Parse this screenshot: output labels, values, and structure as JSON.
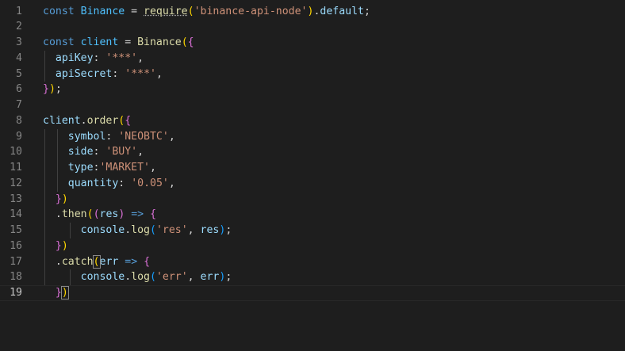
{
  "editor": {
    "active_line": 19,
    "lines": [
      {
        "n": "1",
        "tokens": [
          {
            "t": "const ",
            "c": "kw"
          },
          {
            "t": "Binance",
            "c": "var"
          },
          {
            "t": " = ",
            "c": "op"
          },
          {
            "t": "require",
            "c": "fn",
            "dotted": true
          },
          {
            "t": "(",
            "c": "p1"
          },
          {
            "t": "'binance-api-node'",
            "c": "str"
          },
          {
            "t": ")",
            "c": "p1"
          },
          {
            "t": ".",
            "c": "op"
          },
          {
            "t": "default",
            "c": "prop"
          },
          {
            "t": ";",
            "c": "op"
          }
        ]
      },
      {
        "n": "2",
        "tokens": []
      },
      {
        "n": "3",
        "tokens": [
          {
            "t": "const ",
            "c": "kw"
          },
          {
            "t": "client",
            "c": "var"
          },
          {
            "t": " = ",
            "c": "op"
          },
          {
            "t": "Binance",
            "c": "fn"
          },
          {
            "t": "(",
            "c": "p1"
          },
          {
            "t": "{",
            "c": "p2"
          }
        ]
      },
      {
        "n": "4",
        "tokens": [
          {
            "t": "  ",
            "c": "op"
          },
          {
            "t": "apiKey",
            "c": "prop"
          },
          {
            "t": ": ",
            "c": "op"
          },
          {
            "t": "'***'",
            "c": "str"
          },
          {
            "t": ",",
            "c": "op"
          }
        ]
      },
      {
        "n": "5",
        "tokens": [
          {
            "t": "  ",
            "c": "op"
          },
          {
            "t": "apiSecret",
            "c": "prop"
          },
          {
            "t": ": ",
            "c": "op"
          },
          {
            "t": "'***'",
            "c": "str"
          },
          {
            "t": ",",
            "c": "op"
          }
        ]
      },
      {
        "n": "6",
        "tokens": [
          {
            "t": "}",
            "c": "p2"
          },
          {
            "t": ")",
            "c": "p1"
          },
          {
            "t": ";",
            "c": "op"
          }
        ]
      },
      {
        "n": "7",
        "tokens": []
      },
      {
        "n": "8",
        "tokens": [
          {
            "t": "client",
            "c": "prop"
          },
          {
            "t": ".",
            "c": "op"
          },
          {
            "t": "order",
            "c": "fn"
          },
          {
            "t": "(",
            "c": "p1"
          },
          {
            "t": "{",
            "c": "p2"
          }
        ]
      },
      {
        "n": "9",
        "tokens": [
          {
            "t": "    ",
            "c": "op"
          },
          {
            "t": "symbol",
            "c": "prop"
          },
          {
            "t": ": ",
            "c": "op"
          },
          {
            "t": "'NEOBTC'",
            "c": "str"
          },
          {
            "t": ",",
            "c": "op"
          }
        ]
      },
      {
        "n": "10",
        "tokens": [
          {
            "t": "    ",
            "c": "op"
          },
          {
            "t": "side",
            "c": "prop"
          },
          {
            "t": ": ",
            "c": "op"
          },
          {
            "t": "'BUY'",
            "c": "str"
          },
          {
            "t": ",",
            "c": "op"
          }
        ]
      },
      {
        "n": "11",
        "tokens": [
          {
            "t": "    ",
            "c": "op"
          },
          {
            "t": "type",
            "c": "prop"
          },
          {
            "t": ":",
            "c": "op"
          },
          {
            "t": "'MARKET'",
            "c": "str"
          },
          {
            "t": ",",
            "c": "op"
          }
        ]
      },
      {
        "n": "12",
        "tokens": [
          {
            "t": "    ",
            "c": "op"
          },
          {
            "t": "quantity",
            "c": "prop"
          },
          {
            "t": ": ",
            "c": "op"
          },
          {
            "t": "'0.05'",
            "c": "str"
          },
          {
            "t": ",",
            "c": "op"
          }
        ]
      },
      {
        "n": "13",
        "tokens": [
          {
            "t": "  ",
            "c": "op"
          },
          {
            "t": "}",
            "c": "p2"
          },
          {
            "t": ")",
            "c": "p1"
          }
        ]
      },
      {
        "n": "14",
        "tokens": [
          {
            "t": "  ",
            "c": "op"
          },
          {
            "t": ".",
            "c": "op"
          },
          {
            "t": "then",
            "c": "fn"
          },
          {
            "t": "(",
            "c": "p1"
          },
          {
            "t": "(",
            "c": "p2"
          },
          {
            "t": "res",
            "c": "prop"
          },
          {
            "t": ")",
            "c": "p2"
          },
          {
            "t": " => ",
            "c": "kw"
          },
          {
            "t": "{",
            "c": "p2"
          }
        ]
      },
      {
        "n": "15",
        "tokens": [
          {
            "t": "      ",
            "c": "op"
          },
          {
            "t": "console",
            "c": "prop"
          },
          {
            "t": ".",
            "c": "op"
          },
          {
            "t": "log",
            "c": "fn"
          },
          {
            "t": "(",
            "c": "p3"
          },
          {
            "t": "'res'",
            "c": "str"
          },
          {
            "t": ", ",
            "c": "op"
          },
          {
            "t": "res",
            "c": "prop"
          },
          {
            "t": ")",
            "c": "p3"
          },
          {
            "t": ";",
            "c": "op"
          }
        ]
      },
      {
        "n": "16",
        "tokens": [
          {
            "t": "  ",
            "c": "op"
          },
          {
            "t": "}",
            "c": "p2"
          },
          {
            "t": ")",
            "c": "p1"
          }
        ]
      },
      {
        "n": "17",
        "tokens": [
          {
            "t": "  ",
            "c": "op"
          },
          {
            "t": ".",
            "c": "op"
          },
          {
            "t": "catch",
            "c": "fn"
          },
          {
            "t": "(",
            "c": "p1",
            "box": true
          },
          {
            "t": "err",
            "c": "prop"
          },
          {
            "t": " => ",
            "c": "kw"
          },
          {
            "t": "{",
            "c": "p2"
          }
        ]
      },
      {
        "n": "18",
        "tokens": [
          {
            "t": "      ",
            "c": "op"
          },
          {
            "t": "console",
            "c": "prop"
          },
          {
            "t": ".",
            "c": "op"
          },
          {
            "t": "log",
            "c": "fn"
          },
          {
            "t": "(",
            "c": "p3"
          },
          {
            "t": "'err'",
            "c": "str"
          },
          {
            "t": ", ",
            "c": "op"
          },
          {
            "t": "err",
            "c": "prop"
          },
          {
            "t": ")",
            "c": "p3"
          },
          {
            "t": ";",
            "c": "op"
          }
        ]
      },
      {
        "n": "19",
        "tokens": [
          {
            "t": "  ",
            "c": "op"
          },
          {
            "t": "}",
            "c": "p2"
          },
          {
            "t": ")",
            "c": "p1",
            "box": true
          }
        ]
      }
    ]
  },
  "colors": {
    "background": "#1e1e1e",
    "line_number": "#858585",
    "keyword": "#569cd6",
    "string": "#ce9178",
    "function": "#dcdcaa",
    "property": "#9cdcfe",
    "bracket_1": "#ffd700",
    "bracket_2": "#da70d6",
    "bracket_3": "#179fff"
  }
}
